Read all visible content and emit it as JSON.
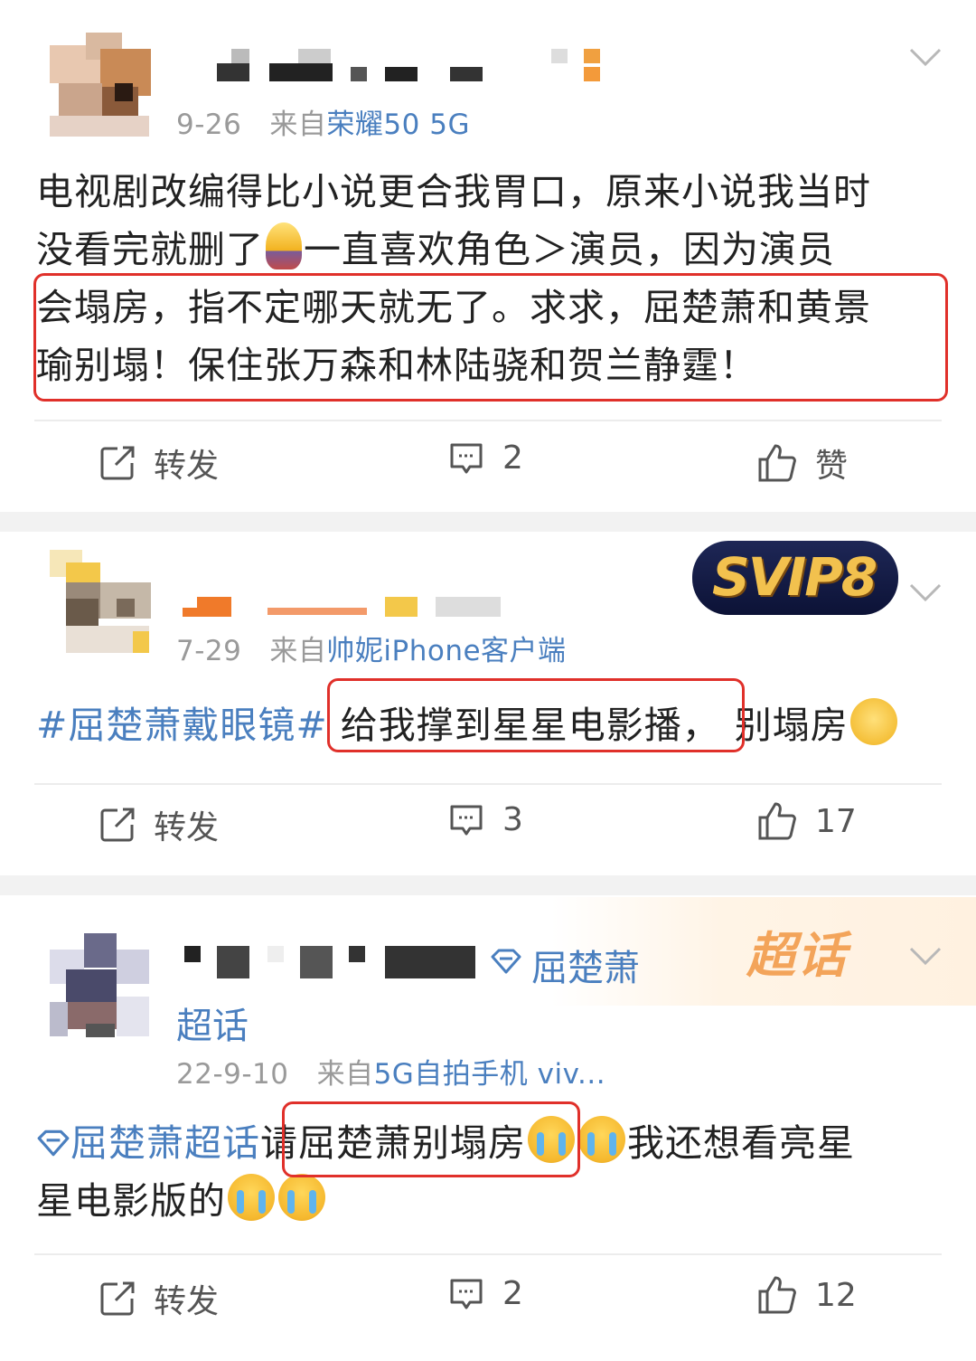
{
  "posts": [
    {
      "date": "9-26",
      "from_prefix": "来自",
      "source": "荣耀50 5G",
      "text_lines": [
        "电视剧改编得比小说更合我胃口，原来小说我当时",
        "没看完就删了",
        "一直喜欢角色＞演员，因为演员",
        "会塌房，指不定哪天就无了。求求，屈楚萧和黄景",
        "瑜别塌！保住张万森和林陆骁和贺兰静霆！"
      ],
      "actions": {
        "repost": "转发",
        "comment": "2",
        "like": "赞"
      }
    },
    {
      "badge": "SVIP8",
      "date": "7-29",
      "from_prefix": "来自",
      "source": "帅妮iPhone客户端",
      "topic": "#屈楚萧戴眼镜#",
      "highlight": "给我撑到星星电影播，",
      "rest": "别塌房",
      "actions": {
        "repost": "转发",
        "comment": "3",
        "like": "17"
      }
    },
    {
      "supertopic_name": "屈楚萧",
      "supertopic_suffix": "超话",
      "supertopic_badge": "超话",
      "date": "22-9-10",
      "from_prefix": "来自",
      "source": "5G自拍手机 viv...",
      "supertopic_link": "屈楚萧超话",
      "highlight": "请屈楚萧别塌房",
      "rest1": "我还想看亮星",
      "rest2": "星电影版的",
      "actions": {
        "repost": "转发",
        "comment": "2",
        "like": "12"
      }
    }
  ],
  "colors": {
    "link": "#4a7fbf",
    "highlight_box": "#e0302a",
    "meta": "#9a9a9a",
    "separator": "#f2f2f2"
  },
  "icons": [
    "chevron-down-icon",
    "repost-icon",
    "comment-icon",
    "like-icon",
    "supertopic-diamond-icon",
    "crying-emoji",
    "laughing-emoji",
    "lightbulb-emoji"
  ]
}
